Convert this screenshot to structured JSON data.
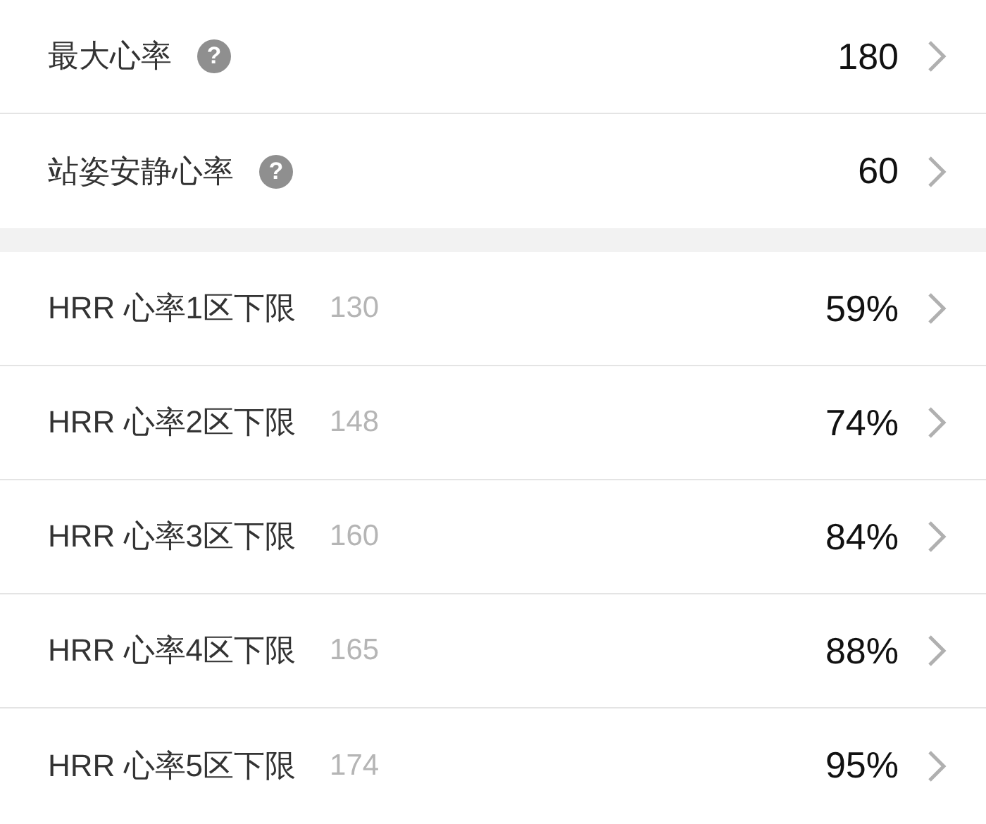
{
  "sections": [
    {
      "rows": [
        {
          "label": "最大心率",
          "help": "?",
          "value": "180"
        },
        {
          "label": "站姿安静心率",
          "help": "?",
          "value": "60"
        }
      ]
    },
    {
      "rows": [
        {
          "label": "HRR 心率1区下限",
          "hint": "130",
          "value": "59%"
        },
        {
          "label": "HRR 心率2区下限",
          "hint": "148",
          "value": "74%"
        },
        {
          "label": "HRR 心率3区下限",
          "hint": "160",
          "value": "84%"
        },
        {
          "label": "HRR 心率4区下限",
          "hint": "165",
          "value": "88%"
        },
        {
          "label": "HRR 心率5区下限",
          "hint": "174",
          "value": "95%"
        }
      ]
    }
  ]
}
